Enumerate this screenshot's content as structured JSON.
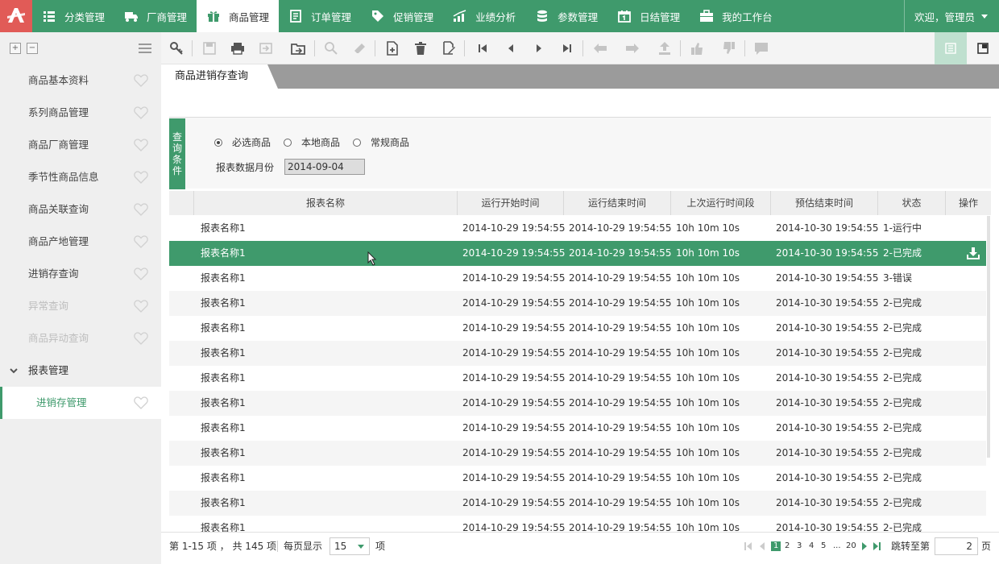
{
  "nav": {
    "items": [
      {
        "label": "分类管理",
        "icon": "list-icon"
      },
      {
        "label": "厂商管理",
        "icon": "truck-icon"
      },
      {
        "label": "商品管理",
        "icon": "gift-icon",
        "active": true
      },
      {
        "label": "订单管理",
        "icon": "order-icon"
      },
      {
        "label": "促销管理",
        "icon": "tag-icon"
      },
      {
        "label": "业绩分析",
        "icon": "chart-icon"
      },
      {
        "label": "参数管理",
        "icon": "database-icon"
      },
      {
        "label": "日结管理",
        "icon": "calendar-icon"
      },
      {
        "label": "我的工作台",
        "icon": "briefcase-icon"
      }
    ],
    "user": "欢迎，管理员"
  },
  "sidebar": {
    "items": [
      {
        "label": "商品基本资料"
      },
      {
        "label": "系列商品管理"
      },
      {
        "label": "商品厂商管理"
      },
      {
        "label": "季节性商品信息"
      },
      {
        "label": "商品关联查询"
      },
      {
        "label": "商品产地管理"
      },
      {
        "label": "进销存查询"
      },
      {
        "label": "异常查询",
        "disabled": true
      },
      {
        "label": "商品异动查询",
        "disabled": true
      }
    ],
    "group": {
      "label": "报表管理",
      "child": "进销存管理"
    }
  },
  "tab": {
    "label": "商品进销存查询"
  },
  "query": {
    "label_chars": [
      "查",
      "询",
      "条",
      "件"
    ],
    "radios": [
      "必选商品",
      "本地商品",
      "常规商品"
    ],
    "month_label": "报表数据月份",
    "month_value": "2014-09-04"
  },
  "grid": {
    "columns": [
      "报表名称",
      "运行开始时间",
      "运行结束时间",
      "上次运行时间段",
      "预估结束时间",
      "状态",
      "操作"
    ],
    "rows": [
      [
        "报表名称1",
        "2014-10-29 19:54:55",
        "2014-10-29 19:54:55",
        "10h 10m 10s",
        "2014-10-30 19:54:55",
        "1-运行中"
      ],
      [
        "报表名称1",
        "2014-10-29 19:54:55",
        "2014-10-29 19:54:55",
        "10h 10m 10s",
        "2014-10-30 19:54:55",
        "2-已完成"
      ],
      [
        "报表名称1",
        "2014-10-29 19:54:55",
        "2014-10-29 19:54:55",
        "10h 10m 10s",
        "2014-10-30 19:54:55",
        "3-错误"
      ],
      [
        "报表名称1",
        "2014-10-29 19:54:55",
        "2014-10-29 19:54:55",
        "10h 10m 10s",
        "2014-10-30 19:54:55",
        "2-已完成"
      ],
      [
        "报表名称1",
        "2014-10-29 19:54:55",
        "2014-10-29 19:54:55",
        "10h 10m 10s",
        "2014-10-30 19:54:55",
        "2-已完成"
      ],
      [
        "报表名称1",
        "2014-10-29 19:54:55",
        "2014-10-29 19:54:55",
        "10h 10m 10s",
        "2014-10-30 19:54:55",
        "2-已完成"
      ],
      [
        "报表名称1",
        "2014-10-29 19:54:55",
        "2014-10-29 19:54:55",
        "10h 10m 10s",
        "2014-10-30 19:54:55",
        "2-已完成"
      ],
      [
        "报表名称1",
        "2014-10-29 19:54:55",
        "2014-10-29 19:54:55",
        "10h 10m 10s",
        "2014-10-30 19:54:55",
        "2-已完成"
      ],
      [
        "报表名称1",
        "2014-10-29 19:54:55",
        "2014-10-29 19:54:55",
        "10h 10m 10s",
        "2014-10-30 19:54:55",
        "2-已完成"
      ],
      [
        "报表名称1",
        "2014-10-29 19:54:55",
        "2014-10-29 19:54:55",
        "10h 10m 10s",
        "2014-10-30 19:54:55",
        "2-已完成"
      ],
      [
        "报表名称1",
        "2014-10-29 19:54:55",
        "2014-10-29 19:54:55",
        "10h 10m 10s",
        "2014-10-30 19:54:55",
        "2-已完成"
      ],
      [
        "报表名称1",
        "2014-10-29 19:54:55",
        "2014-10-29 19:54:55",
        "10h 10m 10s",
        "2014-10-30 19:54:55",
        "2-已完成"
      ],
      [
        "报表名称1",
        "2014-10-29 19:54:55",
        "2014-10-29 19:54:55",
        "10h 10m 10s",
        "2014-10-30 19:54:55",
        "2-已完成"
      ]
    ],
    "selected_row": 1
  },
  "pager": {
    "summary": "第 1-15 项 ， 共 145 项",
    "per_page_label": "每页显示",
    "per_page_value": "15",
    "per_page_unit": "项",
    "pages": [
      "1",
      "2",
      "3",
      "4",
      "5",
      "...",
      "20"
    ],
    "current_page": "1",
    "goto_label": "跳转至第",
    "goto_value": "2",
    "goto_unit": "页"
  },
  "colors": {
    "brand": "#3f9a6c",
    "logo": "#e15b57"
  }
}
